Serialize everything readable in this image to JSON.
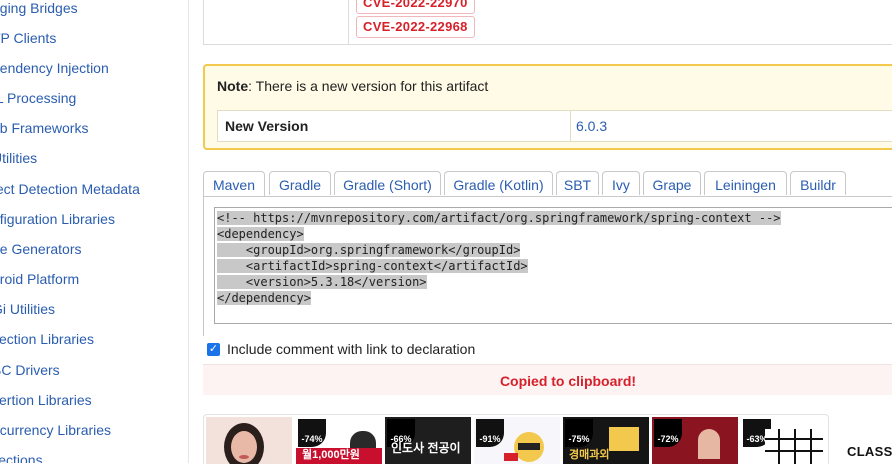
{
  "sidebar": {
    "items": [
      "gging Bridges",
      "TP Clients",
      "pendency Injection",
      "IL Processing",
      "eb Frameworks",
      "Utilities",
      "fect Detection Metadata",
      "nfiguration Libraries",
      "de Generators",
      "droid Platform",
      "Gi Utilities",
      "flection Libraries",
      "BC Drivers",
      "sertion Libraries",
      "ncurrency Libraries",
      "llections"
    ]
  },
  "vulnerabilities": [
    "CVE-2022-22970",
    "CVE-2022-22968"
  ],
  "note": {
    "label": "Note",
    "text": ": There is a new version for this artifact",
    "new_version_label": "New Version",
    "new_version_value": "6.0.3"
  },
  "tabs": [
    "Maven",
    "Gradle",
    "Gradle (Short)",
    "Gradle (Kotlin)",
    "SBT",
    "Ivy",
    "Grape",
    "Leiningen",
    "Buildr"
  ],
  "code": {
    "lines": [
      "<!-- https://mvnrepository.com/artifact/org.springframework/spring-context -->",
      "<dependency>",
      "    <groupId>org.springframework</groupId>",
      "    <artifactId>spring-context</artifactId>",
      "    <version>5.3.18</version>",
      "</dependency>"
    ]
  },
  "include_comment": {
    "checked": true,
    "label": "Include comment with link to declaration"
  },
  "copied_message": "Copied to clipboard!",
  "ads": [
    {
      "badge": "",
      "text": ""
    },
    {
      "badge": "-74%",
      "text": "월1,000만원"
    },
    {
      "badge": "-66%",
      "text": "인도사 전공이"
    },
    {
      "badge": "-91%",
      "text": ""
    },
    {
      "badge": "-75%",
      "text": "경매과외"
    },
    {
      "badge": "-72%",
      "text": ""
    },
    {
      "badge": "-63%",
      "text": ""
    }
  ],
  "class_label": "CLASS",
  "colors": {
    "link": "#2a5db0",
    "cve": "#d6212b",
    "note_border": "#f2c94c",
    "checkbox": "#1a73e8"
  }
}
